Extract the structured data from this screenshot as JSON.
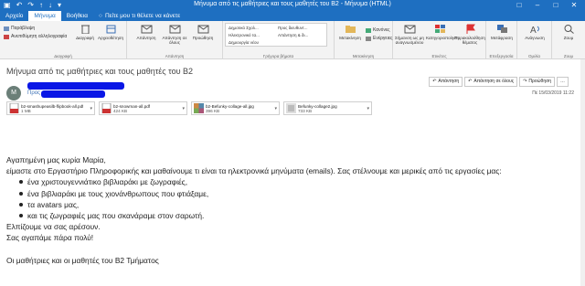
{
  "window": {
    "title": "Μήνυμα από τις μαθήτριες και τους μαθητές του Β2  -  Μήνυμα (HTML)"
  },
  "menubar": {
    "file": "Αρχείο",
    "message": "Μήνυμα",
    "help": "Βοήθεια",
    "tell_me": "Πείτε μου τι θέλετε να κάνετε"
  },
  "ribbon": {
    "delete_group": {
      "ignore": "Παράβλεψη",
      "junk": "Ανεπιθύμητη αλληλογραφία",
      "delete": "Διαγραφή",
      "archive": "Αρχειοθέτηση",
      "label": "Διαγραφή"
    },
    "respond_group": {
      "reply": "Απάντηση",
      "reply_all": "Απάντηση σε όλους",
      "forward": "Προώθηση",
      "label": "Απάντηση"
    },
    "quicksteps_group": {
      "items": [
        "Δημοτικό Σχολ...",
        "Ηλεκτρονικό τα...",
        "Δημιουργία νέου",
        "Προς διευθυντ...",
        "Απάντηση & δι..."
      ],
      "label": "Γρήγορα βήματα"
    },
    "move_group": {
      "move": "Μετακίνηση",
      "rules": "Κανόνες",
      "onenote": "Ενέργειες",
      "label": "Μετακίνηση"
    },
    "tags_group": {
      "mark_unread": "Σήμανση ως μη αναγνωσμένου",
      "categorize": "Κατηγοριοποίηση",
      "followup": "Παρακολούθηση θέματος",
      "label": "Ετικέτες"
    },
    "editing_group": {
      "translate": "Μετάφραση",
      "label": "Επεξεργασία"
    },
    "speech_group": {
      "read_aloud": "Ανάγνωση",
      "label": "Ομιλία"
    },
    "zoom_group": {
      "zoom": "Ζουμ",
      "label": "Ζουμ"
    }
  },
  "message": {
    "subject": "Μήνυμα από τις μαθήτριες και τους μαθητές του Β2",
    "avatar_initial": "M",
    "to_label": "Προς",
    "datetime": "Πέ 15/03/2019 11:22",
    "actions": {
      "reply": "Απάντηση",
      "reply_all": "Απάντηση σε όλους",
      "forward": "Προώθηση"
    },
    "attachments": [
      {
        "name": "b2-smashupeasilb-flipbook-all.pdf",
        "size": "1 MB",
        "type": "pdf"
      },
      {
        "name": "b2-snowman-all.pdf",
        "size": "424 KB",
        "type": "pdf"
      },
      {
        "name": "b2-Befunky-collage-all.jpg",
        "size": "396 KB",
        "type": "jpg"
      },
      {
        "name": "Befunky-collage2.jpg",
        "size": "733 KB",
        "type": "jpg"
      }
    ],
    "body": {
      "greeting": "Αγαπημένη μας κυρία Μαρία,",
      "para1": "είμαστε στο Εργαστήριο Πληροφορικής και μαθαίνουμε τι είναι τα ηλεκτρονικά μηνύματα (emails). Σας στέλνουμε και μερικές από τις εργασίες μας:",
      "bullets": [
        "ένα χριστουγεννιάτικο βιβλιαράκι με ζωγραφιές,",
        "ένα βιβλιαράκι με τους χιονάνθρωπους που φτιάξαμε,",
        "τα avatars μας,",
        "και τις ζωγραφιές μας που σκανάραμε στον σαρωτή."
      ],
      "line_hope": "Ελπίζουμε να σας αρέσουν.",
      "line_love": "Σας αγαπάμε πάρα πολύ!",
      "signature": "Οι μαθήτριες και οι μαθητές του Β2 Τμήματος"
    }
  },
  "colors": {
    "accent": "#1e6fc1",
    "redaction": "#0a17e6"
  }
}
